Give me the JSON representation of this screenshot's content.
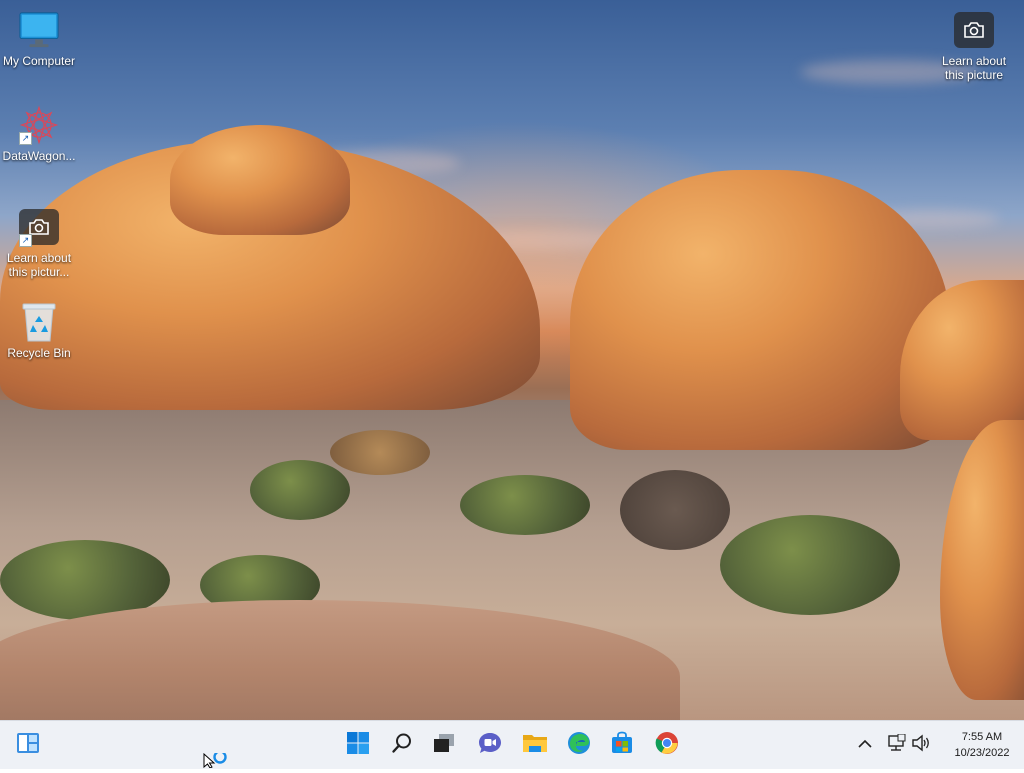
{
  "desktop": {
    "icons": [
      {
        "label": "My Computer",
        "icon": "monitor-icon"
      },
      {
        "label": "DataWagon...",
        "icon": "datawagon-logo-icon"
      },
      {
        "label": "Learn about this pictur...",
        "icon": "camera-icon"
      },
      {
        "label": "Recycle Bin",
        "icon": "recycle-bin-icon"
      }
    ],
    "spotlight": {
      "label": "Learn about this picture",
      "icon": "camera-icon"
    }
  },
  "taskbar": {
    "widgets": "widgets-icon",
    "apps": [
      {
        "name": "Start",
        "icon": "windows-logo-icon"
      },
      {
        "name": "Search",
        "icon": "search-icon"
      },
      {
        "name": "Task View",
        "icon": "task-view-icon"
      },
      {
        "name": "Chat",
        "icon": "chat-icon"
      },
      {
        "name": "File Explorer",
        "icon": "folder-icon"
      },
      {
        "name": "Microsoft Edge",
        "icon": "edge-icon"
      },
      {
        "name": "Microsoft Store",
        "icon": "store-icon"
      },
      {
        "name": "Google Chrome",
        "icon": "chrome-icon"
      }
    ],
    "tray": {
      "time": "7:55 AM",
      "date": "10/23/2022"
    }
  },
  "colors": {
    "taskbar_bg": "#eef1f6",
    "windows_blue": "#0a78d7"
  }
}
